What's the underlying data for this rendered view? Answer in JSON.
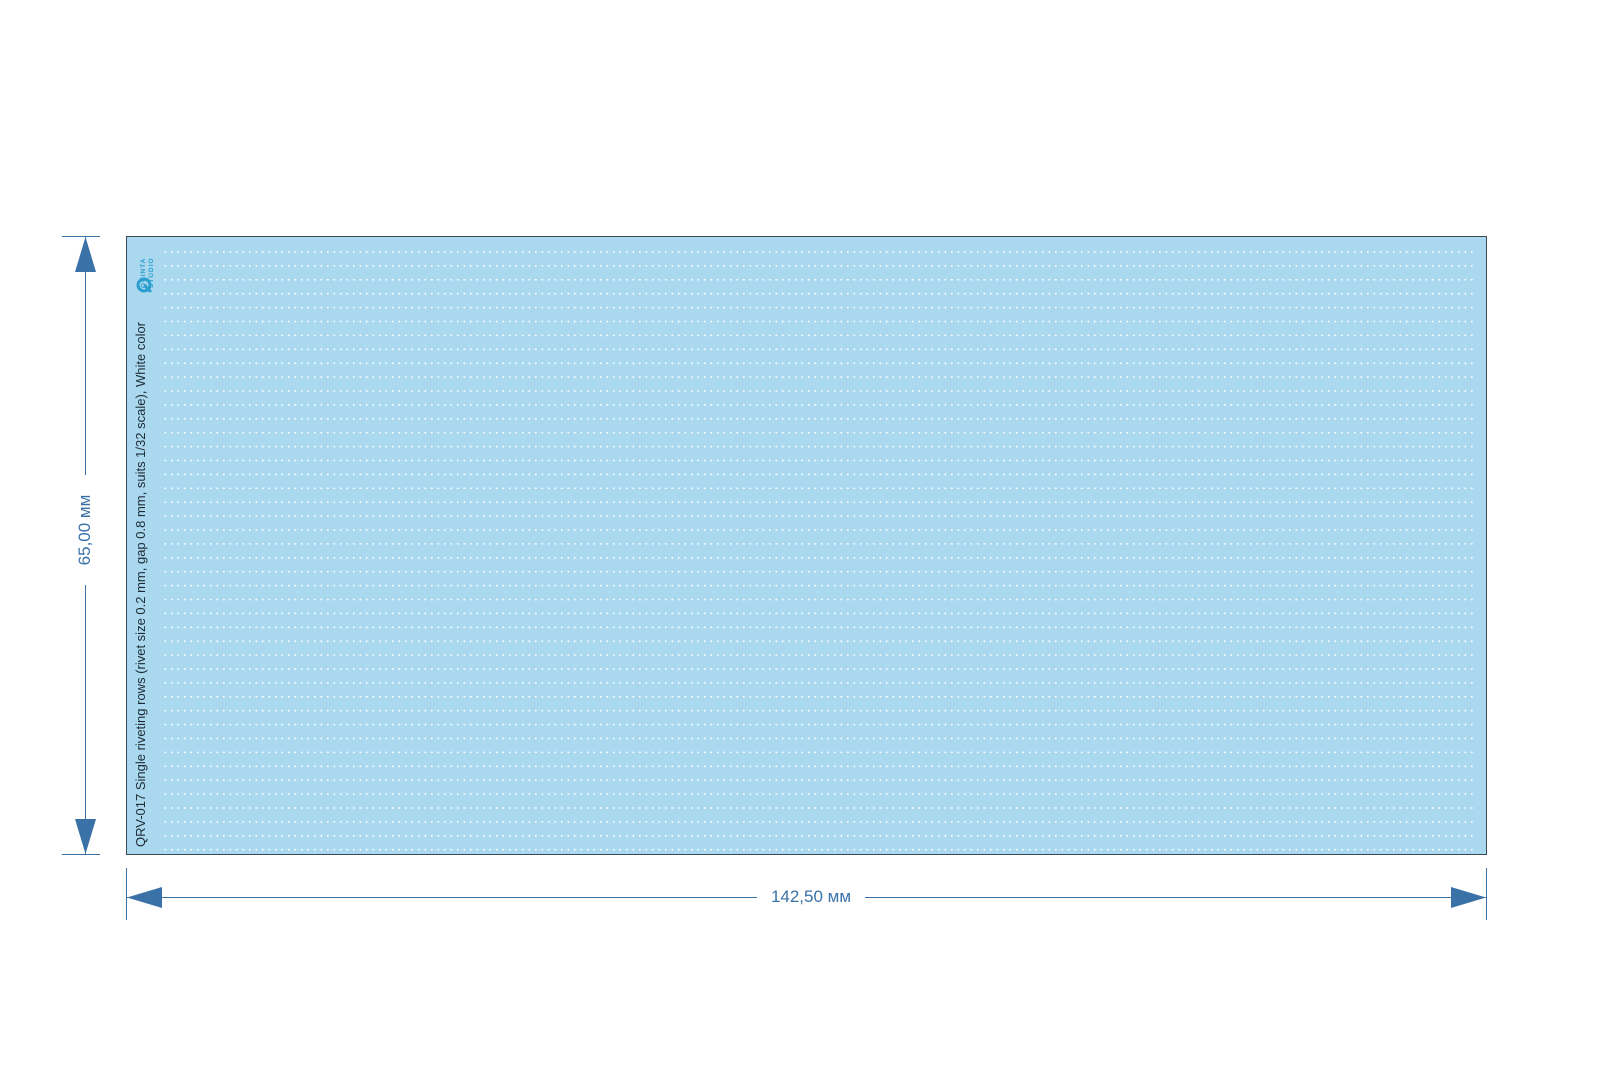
{
  "sheet": {
    "caption": "QRV-017 Single riveting rows (rivet size 0.2 mm, gap 0.8 mm, suits 1/32 scale), White color",
    "background_color": "#a9d8ef",
    "rivet_color": "#ffffff",
    "row_count": 45
  },
  "brand": {
    "line1": "QUINTA",
    "line2": "STUDIO",
    "color": "#2a9fcf",
    "icon": "quinta-studio-logo-icon"
  },
  "dimensions": {
    "width_label": "142,50 мм",
    "height_label": "65,00 мм",
    "color": "#3a72a8"
  }
}
